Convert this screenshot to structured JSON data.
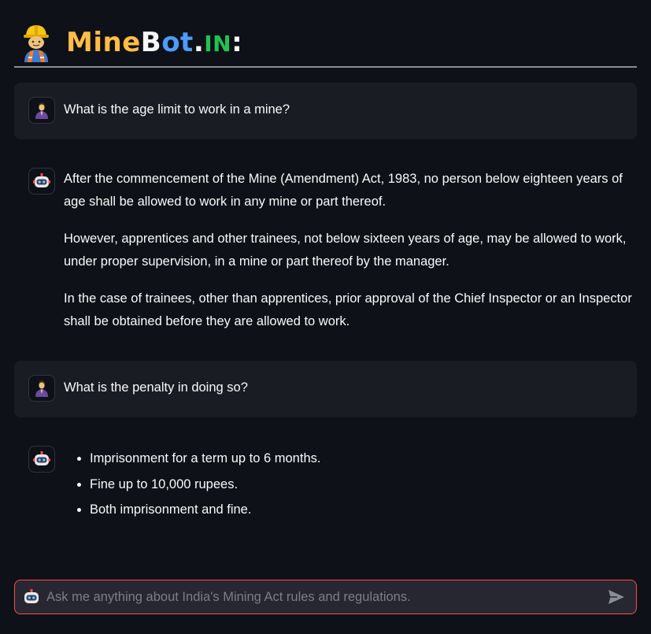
{
  "header": {
    "title_part1": "Mine",
    "title_part2a": "B",
    "title_part2b": "ot",
    "title_dot": ".",
    "title_in": "IN",
    "title_colon": ":",
    "icon": "construction-worker-emoji"
  },
  "messages": [
    {
      "role": "user",
      "icon": "person-in-suit-icon",
      "text": "What is the age limit to work in a mine?"
    },
    {
      "role": "assistant",
      "icon": "robot-icon",
      "paragraphs": [
        "After the commencement of the Mine (Amendment) Act, 1983, no person below eighteen years of age shall be allowed to work in any mine or part thereof.",
        "However, apprentices and other trainees, not below sixteen years of age, may be allowed to work, under proper supervision, in a mine or part thereof by the manager.",
        "In the case of trainees, other than apprentices, prior approval of the Chief Inspector or an Inspector shall be obtained before they are allowed to work."
      ]
    },
    {
      "role": "user",
      "icon": "person-in-suit-icon",
      "text": "What is the penalty in doing so?"
    },
    {
      "role": "assistant",
      "icon": "robot-icon",
      "bullets": [
        "Imprisonment for a term up to 6 months.",
        "Fine up to 10,000 rupees.",
        "Both imprisonment and fine."
      ]
    }
  ],
  "chat_input": {
    "placeholder": "Ask me anything about India's Mining Act rules and regulations.",
    "value": "",
    "send_icon": "send-icon"
  },
  "colors": {
    "background": "#0e1117",
    "user_bubble": "#1a1c24",
    "accent_red": "#ff4b4b",
    "title_orange": "#ffbd45",
    "title_blue": "#4a9dfb",
    "title_green": "#21c354"
  }
}
